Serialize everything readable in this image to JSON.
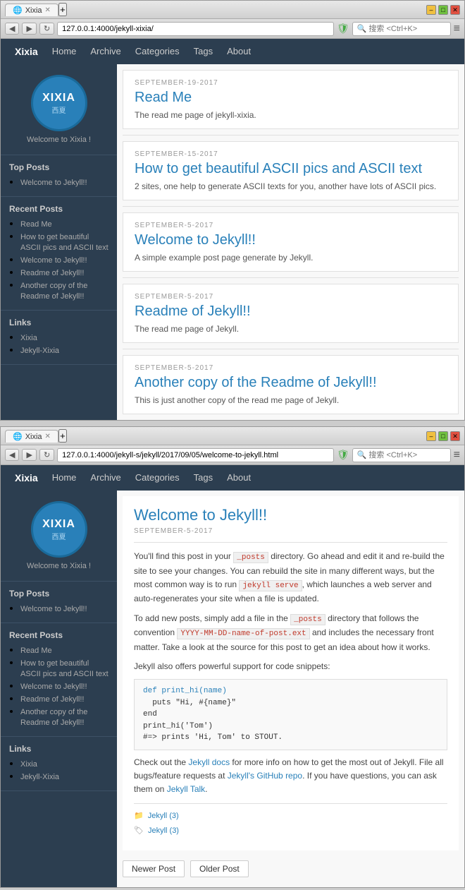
{
  "browser1": {
    "title": "Xixia",
    "url": "127.0.0.1:4000/jekyll-xixia/",
    "search_placeholder": "🔍 搜索 <Ctrl+K>",
    "nav": {
      "brand": "Xixia",
      "links": [
        "Home",
        "Archive",
        "Categories",
        "Tags",
        "About"
      ]
    },
    "sidebar": {
      "logo_main": "XIXIA",
      "logo_sub": "西夏",
      "tagline": "Welcome to Xixia !",
      "top_posts_title": "Top Posts",
      "top_posts": [
        {
          "label": "Welcome to Jekyll!!"
        }
      ],
      "recent_posts_title": "Recent Posts",
      "recent_posts": [
        {
          "label": "Read Me"
        },
        {
          "label": "How to get beautiful ASCII pics and ASCII text"
        },
        {
          "label": "Welcome to Jekyll!!"
        },
        {
          "label": "Readme of Jekyll!!"
        },
        {
          "label": "Another copy of the Readme of Jekyll!!"
        }
      ],
      "links_title": "Links",
      "links": [
        {
          "label": "Xixia"
        },
        {
          "label": "Jekyll-Xixia"
        }
      ]
    },
    "posts": [
      {
        "date": "SEPTEMBER-19-2017",
        "title": "Read Me",
        "excerpt": "The read me page of jekyll-xixia."
      },
      {
        "date": "SEPTEMBER-15-2017",
        "title": "How to get beautiful ASCII pics and ASCII text",
        "excerpt": "2 sites, one help to generate ASCII texts for you, another have lots of ASCII pics."
      },
      {
        "date": "SEPTEMBER-5-2017",
        "title": "Welcome to Jekyll!!",
        "excerpt": "A simple example post page generate by Jekyll."
      },
      {
        "date": "SEPTEMBER-5-2017",
        "title": "Readme of Jekyll!!",
        "excerpt": "The read me page of Jekyll."
      },
      {
        "date": "SEPTEMBER-5-2017",
        "title": "Another copy of the Readme of Jekyll!!",
        "excerpt": "This is just another copy of the read me page of Jekyll."
      }
    ]
  },
  "browser2": {
    "title": "Xixia",
    "url": "127.0.0.1:4000/jekyll-s/jekyll/2017/09/05/welcome-to-jekyll.html",
    "search_placeholder": "🔍 搜索 <Ctrl+K>",
    "nav": {
      "brand": "Xixia",
      "links": [
        "Home",
        "Archive",
        "Categories",
        "Tags",
        "About"
      ]
    },
    "sidebar": {
      "logo_main": "XIXIA",
      "logo_sub": "西夏",
      "tagline": "Welcome to Xixia !",
      "top_posts_title": "Top Posts",
      "top_posts": [
        {
          "label": "Welcome to Jekyll!!"
        }
      ],
      "recent_posts_title": "Recent Posts",
      "recent_posts": [
        {
          "label": "Read Me"
        },
        {
          "label": "How to get beautiful ASCII pics and ASCII text"
        },
        {
          "label": "Welcome to Jekyll!!"
        },
        {
          "label": "Readme of Jekyll!!"
        },
        {
          "label": "Another copy of the Readme of Jekyll!!"
        }
      ],
      "links_title": "Links",
      "links": [
        {
          "label": "Xixia"
        },
        {
          "label": "Jekyll-Xixia"
        }
      ]
    },
    "post": {
      "title": "Welcome to Jekyll!!",
      "date": "SEPTEMBER-5-2017",
      "paragraphs": [
        "You'll find this post in your _posts directory. Go ahead and edit it and re-build the site to see your changes. You can rebuild the site in many different ways, but the most common way is to run jekyll serve, which launches a web server and auto-regenerates your site when a file is updated.",
        "To add new posts, simply add a file in the _posts directory that follows the convention YYYY-MM-DD-name-of-post.ext and includes the necessary front matter. Take a look at the source for this post to get an idea about how it works.",
        "Jekyll also offers powerful support for code snippets:"
      ],
      "code": [
        "def print_hi(name)",
        "  puts \"Hi, #{name}\"",
        "end",
        "print_hi('Tom')",
        "#=> prints 'Hi, Tom' to STOUT."
      ],
      "paragraph_after": "Check out the Jekyll docs for more info on how to get the most out of Jekyll. File all bugs/feature requests at Jekyll's GitHub repo. If you have questions, you can ask them on Jekyll Talk.",
      "category_label": "Jekyll (3)",
      "tag_label": "Jekyll (3)",
      "nav_newer": "Newer Post",
      "nav_older": "Older Post"
    }
  }
}
